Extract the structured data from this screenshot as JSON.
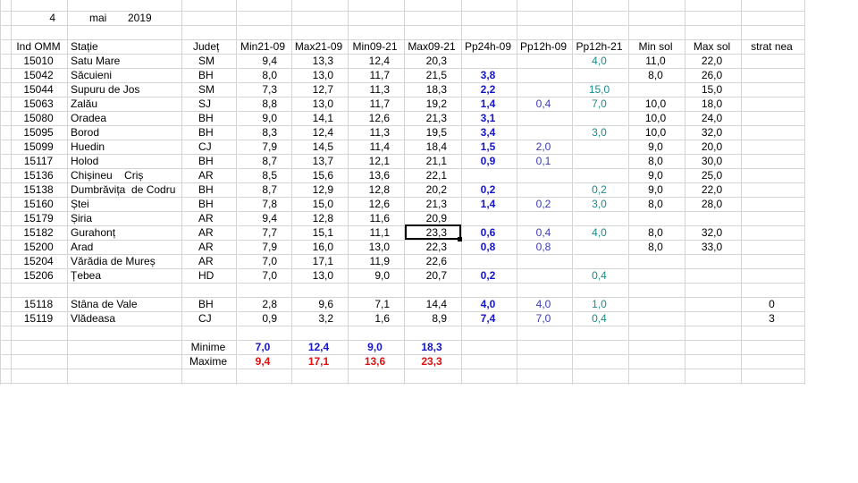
{
  "header": {
    "day": "4",
    "month": "mai",
    "year": "2019"
  },
  "columns": [
    "Ind OMM",
    "Stație",
    "Județ",
    "Min21-09",
    "Max21-09",
    "Min09-21",
    "Max09-21",
    "Pp24h-09",
    "Pp12h-09",
    "Pp12h-21",
    "Min sol",
    "Max sol",
    "strat nea"
  ],
  "rows": [
    {
      "id": "15010",
      "station": "Satu Mare",
      "county": "SM",
      "min2109": "9,4",
      "max2109": "13,3",
      "min0921": "12,4",
      "max0921": "20,3",
      "pp24": "",
      "pp12a": "",
      "pp12b": "4,0",
      "minsol": "11,0",
      "maxsol": "22,0",
      "snow": ""
    },
    {
      "id": "15042",
      "station": "Săcuieni",
      "county": "BH",
      "min2109": "8,0",
      "max2109": "13,0",
      "min0921": "11,7",
      "max0921": "21,5",
      "pp24": "3,8",
      "pp12a": "",
      "pp12b": "",
      "minsol": "8,0",
      "maxsol": "26,0",
      "snow": ""
    },
    {
      "id": "15044",
      "station": "Supuru de Jos",
      "county": "SM",
      "min2109": "7,3",
      "max2109": "12,7",
      "min0921": "11,3",
      "max0921": "18,3",
      "pp24": "2,2",
      "pp12a": "",
      "pp12b": "15,0",
      "minsol": "",
      "maxsol": "15,0",
      "snow": ""
    },
    {
      "id": "15063",
      "station": "Zalău",
      "county": "SJ",
      "min2109": "8,8",
      "max2109": "13,0",
      "min0921": "11,7",
      "max0921": "19,2",
      "pp24": "1,4",
      "pp12a": "0,4",
      "pp12b": "7,0",
      "minsol": "10,0",
      "maxsol": "18,0",
      "snow": ""
    },
    {
      "id": "15080",
      "station": "Oradea",
      "county": "BH",
      "min2109": "9,0",
      "max2109": "14,1",
      "min0921": "12,6",
      "max0921": "21,3",
      "pp24": "3,1",
      "pp12a": "",
      "pp12b": "",
      "minsol": "10,0",
      "maxsol": "24,0",
      "snow": ""
    },
    {
      "id": "15095",
      "station": "Borod",
      "county": "BH",
      "min2109": "8,3",
      "max2109": "12,4",
      "min0921": "11,3",
      "max0921": "19,5",
      "pp24": "3,4",
      "pp12a": "",
      "pp12b": "3,0",
      "minsol": "10,0",
      "maxsol": "32,0",
      "snow": ""
    },
    {
      "id": "15099",
      "station": "Huedin",
      "county": "CJ",
      "min2109": "7,9",
      "max2109": "14,5",
      "min0921": "11,4",
      "max0921": "18,4",
      "pp24": "1,5",
      "pp12a": "2,0",
      "pp12b": "",
      "minsol": "9,0",
      "maxsol": "20,0",
      "snow": ""
    },
    {
      "id": "15117",
      "station": "Holod",
      "county": "BH",
      "min2109": "8,7",
      "max2109": "13,7",
      "min0921": "12,1",
      "max0921": "21,1",
      "pp24": "0,9",
      "pp12a": "0,1",
      "pp12b": "",
      "minsol": "8,0",
      "maxsol": "30,0",
      "snow": ""
    },
    {
      "id": "15136",
      "station": "Chișineu    Criș",
      "county": "AR",
      "min2109": "8,5",
      "max2109": "15,6",
      "min0921": "13,6",
      "max0921": "22,1",
      "pp24": "",
      "pp12a": "",
      "pp12b": "",
      "minsol": "9,0",
      "maxsol": "25,0",
      "snow": ""
    },
    {
      "id": "15138",
      "station": "Dumbrăvița  de Codru",
      "county": "BH",
      "min2109": "8,7",
      "max2109": "12,9",
      "min0921": "12,8",
      "max0921": "20,2",
      "pp24": "0,2",
      "pp12a": "",
      "pp12b": "0,2",
      "minsol": "9,0",
      "maxsol": "22,0",
      "snow": ""
    },
    {
      "id": "15160",
      "station": "Ștei",
      "county": "BH",
      "min2109": "7,8",
      "max2109": "15,0",
      "min0921": "12,6",
      "max0921": "21,3",
      "pp24": "1,4",
      "pp12a": "0,2",
      "pp12b": "3,0",
      "minsol": "8,0",
      "maxsol": "28,0",
      "snow": ""
    },
    {
      "id": "15179",
      "station": "Șiria",
      "county": "AR",
      "min2109": "9,4",
      "max2109": "12,8",
      "min0921": "11,6",
      "max0921": "20,9",
      "pp24": "",
      "pp12a": "",
      "pp12b": "",
      "minsol": "",
      "maxsol": "",
      "snow": ""
    },
    {
      "id": "15182",
      "station": "Gurahonț",
      "county": "AR",
      "min2109": "7,7",
      "max2109": "15,1",
      "min0921": "11,1",
      "max0921": "23,3",
      "pp24": "0,6",
      "pp12a": "0,4",
      "pp12b": "4,0",
      "minsol": "8,0",
      "maxsol": "32,0",
      "snow": ""
    },
    {
      "id": "15200",
      "station": "Arad",
      "county": "AR",
      "min2109": "7,9",
      "max2109": "16,0",
      "min0921": "13,0",
      "max0921": "22,3",
      "pp24": "0,8",
      "pp12a": "0,8",
      "pp12b": "",
      "minsol": "8,0",
      "maxsol": "33,0",
      "snow": ""
    },
    {
      "id": "15204",
      "station": "Vărădia de Mureș",
      "county": "AR",
      "min2109": "7,0",
      "max2109": "17,1",
      "min0921": "11,9",
      "max0921": "22,6",
      "pp24": "",
      "pp12a": "",
      "pp12b": "",
      "minsol": "",
      "maxsol": "",
      "snow": ""
    },
    {
      "id": "15206",
      "station": "Țebea",
      "county": "HD",
      "min2109": "7,0",
      "max2109": "13,0",
      "min0921": "9,0",
      "max0921": "20,7",
      "pp24": "0,2",
      "pp12a": "",
      "pp12b": "0,4",
      "minsol": "",
      "maxsol": "",
      "snow": ""
    },
    {
      "id": "",
      "station": "",
      "county": "",
      "min2109": "",
      "max2109": "",
      "min0921": "",
      "max0921": "",
      "pp24": "",
      "pp12a": "",
      "pp12b": "",
      "minsol": "",
      "maxsol": "",
      "snow": ""
    },
    {
      "id": "15118",
      "station": "Stâna de Vale",
      "county": "BH",
      "min2109": "2,8",
      "max2109": "9,6",
      "min0921": "7,1",
      "max0921": "14,4",
      "pp24": "4,0",
      "pp12a": "4,0",
      "pp12b": "1,0",
      "minsol": "",
      "maxsol": "",
      "snow": "0"
    },
    {
      "id": "15119",
      "station": "Vlădeasa",
      "county": "CJ",
      "min2109": "0,9",
      "max2109": "3,2",
      "min0921": "1,6",
      "max0921": "8,9",
      "pp24": "7,4",
      "pp12a": "7,0",
      "pp12b": "0,4",
      "minsol": "",
      "maxsol": "",
      "snow": "3"
    }
  ],
  "summary": {
    "min_label": "Minime",
    "max_label": "Maxime",
    "minime": [
      "7,0",
      "12,4",
      "9,0",
      "18,3"
    ],
    "maxime": [
      "9,4",
      "17,1",
      "13,6",
      "23,3"
    ]
  },
  "colors": {
    "grid": "#d4d4d4",
    "blue_bold": "#1515c8",
    "blue_light": "#3a3ab8",
    "teal": "#1a8a8a",
    "red": "#e01010"
  }
}
